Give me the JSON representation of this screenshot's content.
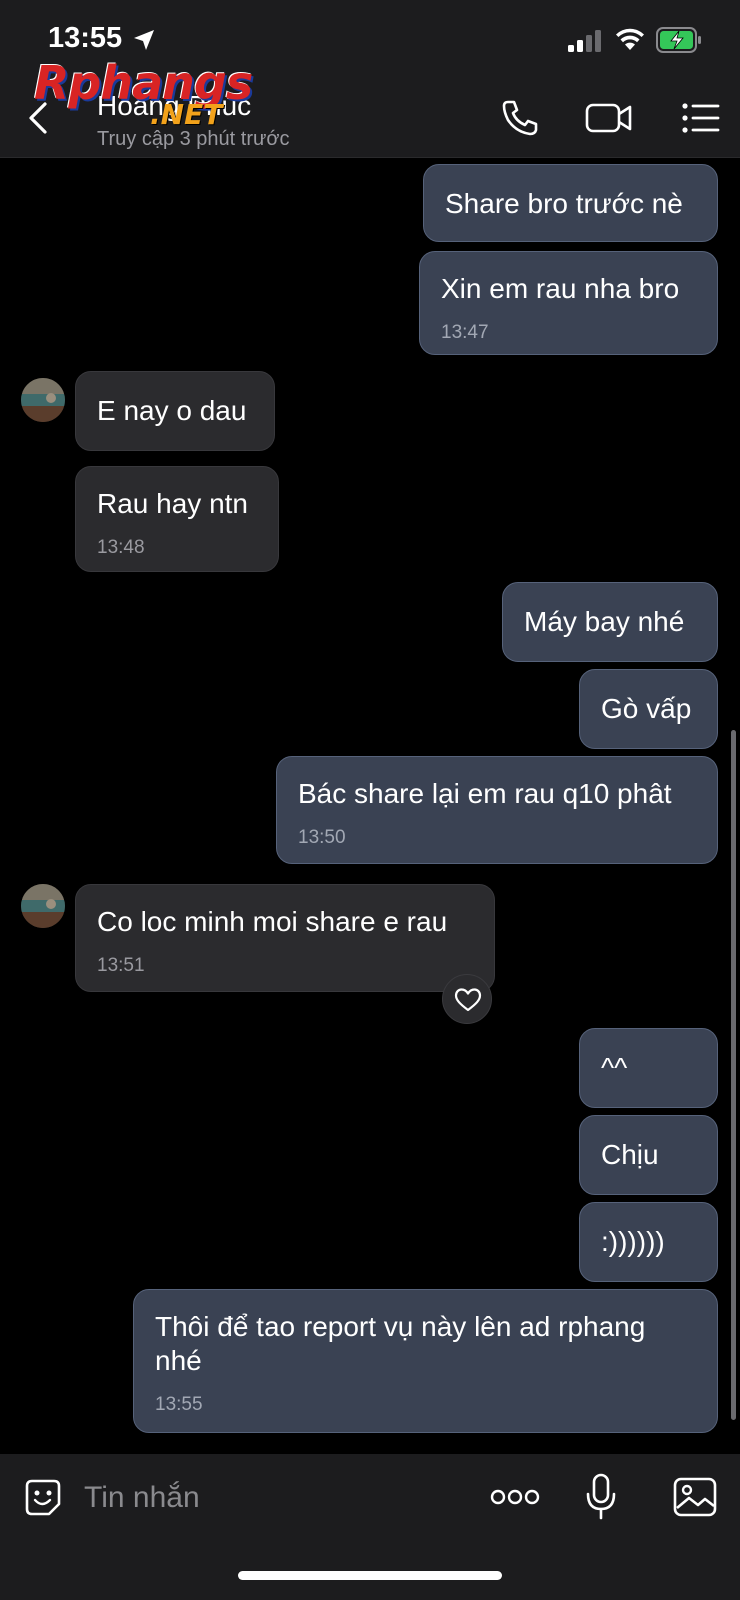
{
  "status_bar": {
    "time": "13:55"
  },
  "header": {
    "contact_name": "Hoàng Phúc",
    "contact_status": "Truy cập 3 phút trước"
  },
  "watermark": {
    "main": "Rphangs",
    "sub": ".NET"
  },
  "messages": [
    {
      "dir": "out",
      "text": "Share bro trước nè",
      "time": ""
    },
    {
      "dir": "out",
      "text": "Xin em rau nha bro",
      "time": "13:47"
    },
    {
      "dir": "in",
      "text": "E nay o dau",
      "time": ""
    },
    {
      "dir": "in",
      "text": "Rau hay ntn",
      "time": "13:48"
    },
    {
      "dir": "out",
      "text": "Máy bay nhé",
      "time": ""
    },
    {
      "dir": "out",
      "text": "Gò vấp",
      "time": ""
    },
    {
      "dir": "out",
      "text": "Bác share lại em rau q10 phât",
      "time": "13:50"
    },
    {
      "dir": "in",
      "text": "Co loc minh moi share e rau",
      "time": "13:51",
      "reaction": "heart"
    },
    {
      "dir": "out",
      "text": "^^",
      "time": ""
    },
    {
      "dir": "out",
      "text": "Chịu",
      "time": ""
    },
    {
      "dir": "out",
      "text": ":))))))",
      "time": ""
    },
    {
      "dir": "out",
      "text": "Thôi để tao report vụ này lên ad rphang nhé",
      "time": "13:55"
    }
  ],
  "input": {
    "placeholder": "Tin nhắn"
  },
  "icons": {
    "back": "chevron-left-icon",
    "call": "phone-icon",
    "video": "video-camera-icon",
    "menu": "list-menu-icon",
    "sticker": "sticker-face-icon",
    "more": "more-dots-icon",
    "mic": "microphone-icon",
    "photo": "image-icon",
    "reaction": "heart-icon"
  },
  "colors": {
    "outgoing_bubble": "#3a4253",
    "incoming_bubble": "#2b2b2e",
    "background": "#000000",
    "bars": "#1c1c1e"
  }
}
